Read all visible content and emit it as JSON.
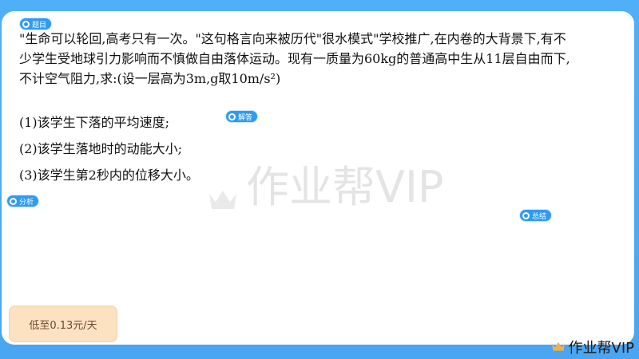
{
  "tags": {
    "question": "题目",
    "answer": "解答",
    "analysis": "分析",
    "summary": "总结"
  },
  "question": {
    "line1": "\"生命可以轮回,高考只有一次。\"这句格言向来被历代\"很水模式\"学校推广,在内卷的大背景下,有不",
    "line2": "少学生受地球引力影响而不慎做自由落体运动。现有一质量为60kg的普通高中生从11层自由而下,",
    "line3": "不计空气阻力,求:(设一层高为3m,g取10m/s²)"
  },
  "items": [
    "(1)该学生下落的平均速度;",
    "(2)该学生落地时的动能大小;",
    "(3)该学生第2秒内的位移大小。"
  ],
  "watermark": "作业帮VIP",
  "promo": "低至0.13元/天",
  "brand": "作业帮VIP",
  "colors": {
    "frame": "#4aa6f2",
    "tag": "#2f9bf4",
    "promo_bg": "#fde2c2",
    "crown": "#f3b04a"
  },
  "icons": {
    "tag_icon": "bulb-icon",
    "crown": "crown-icon"
  }
}
